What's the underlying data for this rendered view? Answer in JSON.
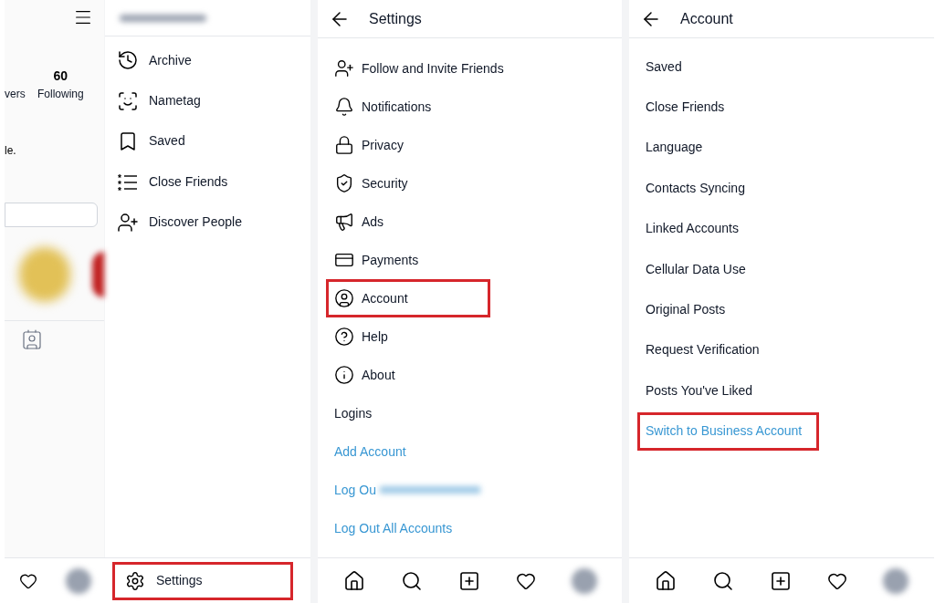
{
  "profile_screen": {
    "following_count": "60",
    "following_label": "Following",
    "followers_fragment": "vers",
    "bio_fragment": "le."
  },
  "drawer": {
    "items": [
      {
        "label": "Archive"
      },
      {
        "label": "Nametag"
      },
      {
        "label": "Saved"
      },
      {
        "label": "Close Friends"
      },
      {
        "label": "Discover People"
      }
    ],
    "settings": {
      "label": "Settings",
      "highlighted": true
    }
  },
  "settings_screen": {
    "title": "Settings",
    "items": [
      {
        "label": "Follow and Invite Friends",
        "kind": "icon_item",
        "highlighted": false
      },
      {
        "label": "Notifications",
        "kind": "icon_item",
        "highlighted": false
      },
      {
        "label": "Privacy",
        "kind": "icon_item",
        "highlighted": false
      },
      {
        "label": "Security",
        "kind": "icon_item",
        "highlighted": false
      },
      {
        "label": "Ads",
        "kind": "icon_item",
        "highlighted": false
      },
      {
        "label": "Payments",
        "kind": "icon_item",
        "highlighted": false
      },
      {
        "label": "Account",
        "kind": "icon_item",
        "highlighted": true
      },
      {
        "label": "Help",
        "kind": "icon_item",
        "highlighted": false
      },
      {
        "label": "About",
        "kind": "icon_item",
        "highlighted": false
      },
      {
        "label": "Logins",
        "kind": "plain",
        "highlighted": false
      },
      {
        "label": "Add Account",
        "kind": "link",
        "highlighted": false
      },
      {
        "label": "Log Ou",
        "kind": "link_redacted",
        "highlighted": false
      },
      {
        "label": "Log Out All Accounts",
        "kind": "link",
        "highlighted": false
      }
    ]
  },
  "account_screen": {
    "title": "Account",
    "items": [
      {
        "label": "Saved",
        "kind": "plain",
        "highlighted": false
      },
      {
        "label": "Close Friends",
        "kind": "plain",
        "highlighted": false
      },
      {
        "label": "Language",
        "kind": "plain",
        "highlighted": false
      },
      {
        "label": "Contacts Syncing",
        "kind": "plain",
        "highlighted": false
      },
      {
        "label": "Linked Accounts",
        "kind": "plain",
        "highlighted": false
      },
      {
        "label": "Cellular Data Use",
        "kind": "plain",
        "highlighted": false
      },
      {
        "label": "Original Posts",
        "kind": "plain",
        "highlighted": false
      },
      {
        "label": "Request Verification",
        "kind": "plain",
        "highlighted": false
      },
      {
        "label": "Posts You've Liked",
        "kind": "plain",
        "highlighted": false
      },
      {
        "label": "Switch to Business Account",
        "kind": "link",
        "highlighted": true
      }
    ]
  }
}
